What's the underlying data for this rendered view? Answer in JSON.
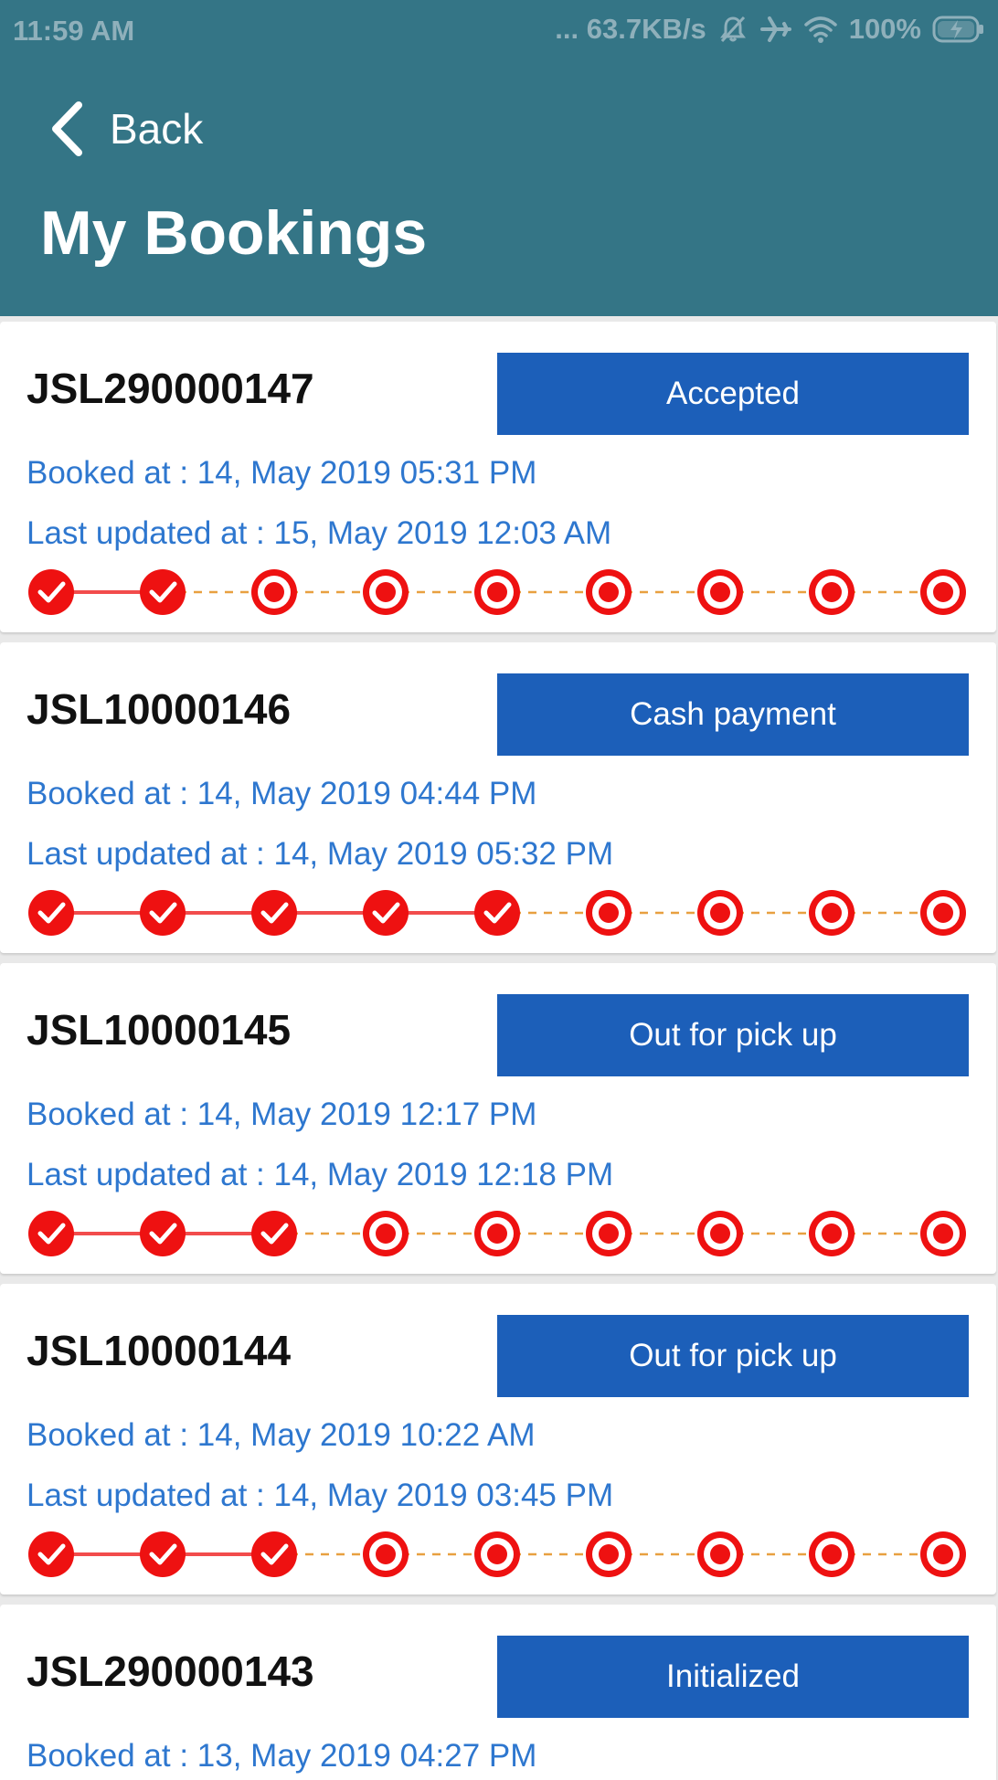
{
  "status_bar": {
    "time": "11:59 AM",
    "network_speed": "... 63.7KB/s",
    "battery": "100%",
    "icons": [
      "mute-icon",
      "airplane-icon",
      "wifi-icon",
      "battery-charging-icon"
    ]
  },
  "header": {
    "back_label": "Back",
    "title": "My Bookings"
  },
  "colors": {
    "header_bg": "#347586",
    "status_button": "#1c5fb9",
    "date_text": "#2e77cf",
    "progress_red": "#ee1111",
    "pending_line": "#e8a040"
  },
  "bookings": [
    {
      "id": "JSL290000147",
      "status": "Accepted",
      "booked_at": "Booked at : 14, May 2019 05:31 PM",
      "last_updated": "Last updated at : 15, May 2019 12:03 AM",
      "completed_steps": 2,
      "total_steps": 9
    },
    {
      "id": "JSL10000146",
      "status": "Cash payment",
      "booked_at": "Booked at : 14, May 2019 04:44 PM",
      "last_updated": "Last updated at : 14, May 2019 05:32 PM",
      "completed_steps": 5,
      "total_steps": 9
    },
    {
      "id": "JSL10000145",
      "status": "Out for pick up",
      "booked_at": "Booked at : 14, May 2019 12:17 PM",
      "last_updated": "Last updated at : 14, May 2019 12:18 PM",
      "completed_steps": 3,
      "total_steps": 9
    },
    {
      "id": "JSL10000144",
      "status": "Out for pick up",
      "booked_at": "Booked at : 14, May 2019 10:22 AM",
      "last_updated": "Last updated at : 14, May 2019 03:45 PM",
      "completed_steps": 3,
      "total_steps": 9
    },
    {
      "id": "JSL290000143",
      "status": "Initialized",
      "booked_at": "Booked at : 13, May 2019 04:27 PM"
    }
  ]
}
